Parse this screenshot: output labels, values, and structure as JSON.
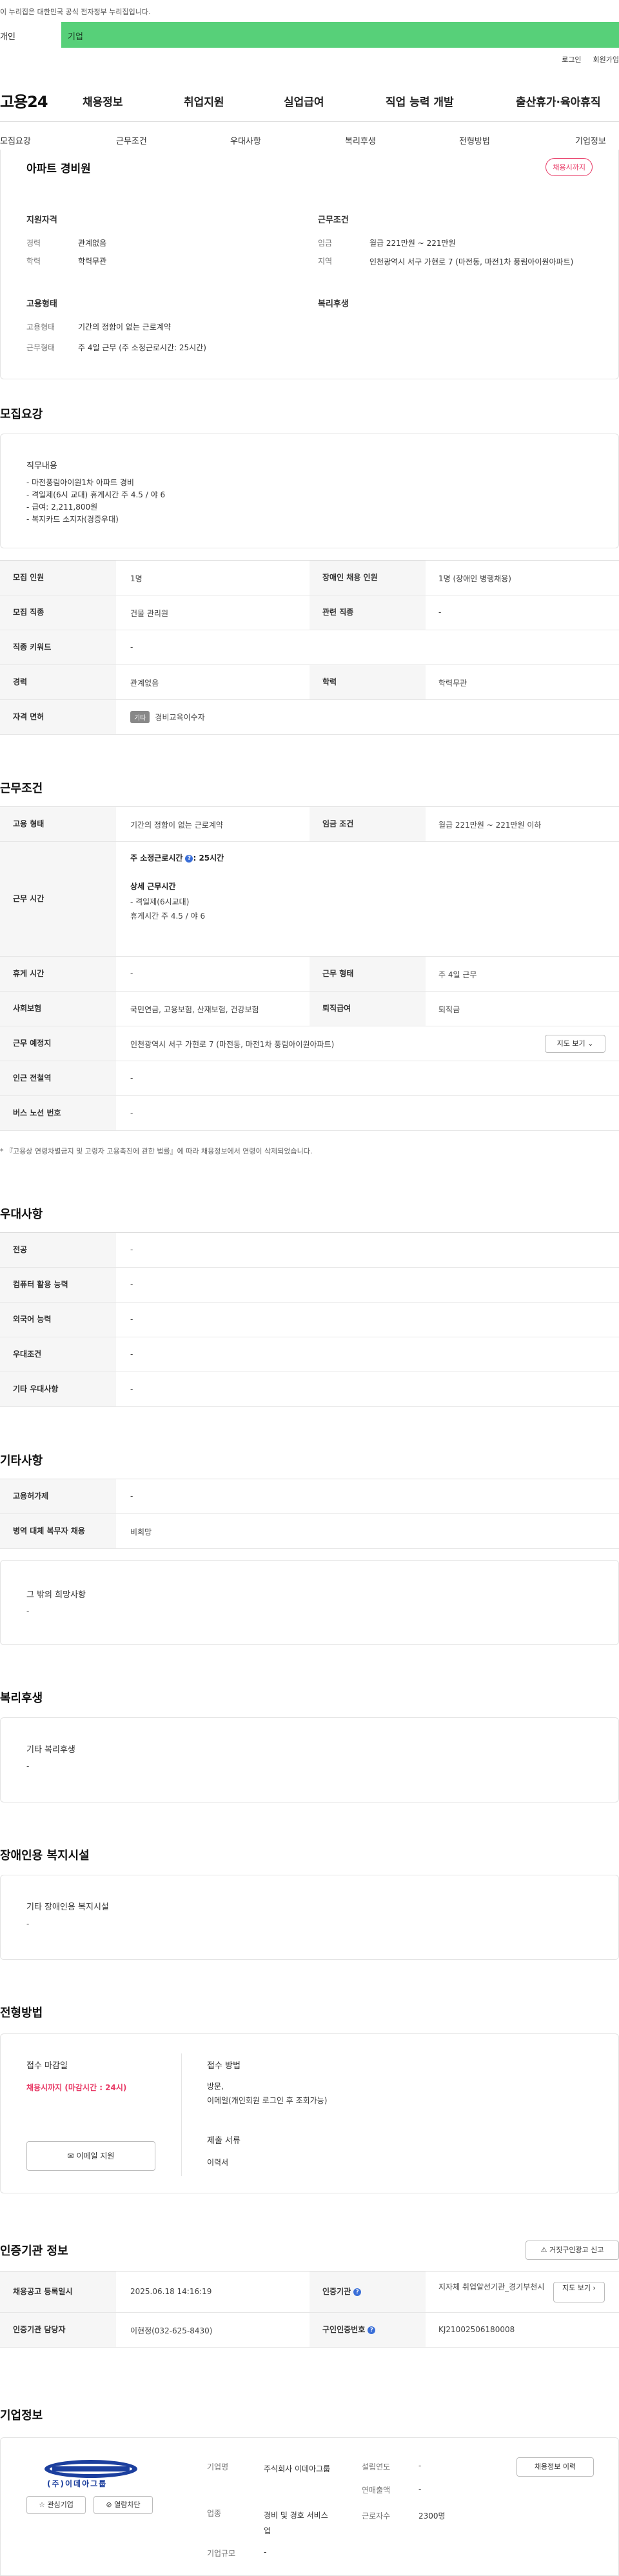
{
  "gov_banner": "이 누리집은 대한민국 공식 전자정부 누리집입니다.",
  "tabs": {
    "individual": "개인",
    "business": "기업"
  },
  "util": {
    "login": "로그인",
    "signup": "회원가입"
  },
  "logo": "고용24",
  "gnb": [
    "채용정보",
    "취업지원",
    "실업급여",
    "직업 능력 개발",
    "출산휴가·육아휴직"
  ],
  "subnav": [
    "모집요강",
    "근무조건",
    "우대사항",
    "복리후생",
    "전형방법",
    "기업정보"
  ],
  "summary": {
    "title": "아파트 경비원",
    "status_badge": "채용시까지",
    "qual_title": "지원자격",
    "career_label": "경력",
    "career_value": "관계없음",
    "edu_label": "학력",
    "edu_value": "학력무관",
    "emp_title": "고용형태",
    "emptype_label": "고용형태",
    "emptype_value": "기간의 정함이 없는 근로계약",
    "workform_label": "근무형태",
    "workform_value": "주 4일 근무 (주 소정근로시간: 25시간)",
    "cond_title": "근무조건",
    "wage_label": "임금",
    "wage_value": "월급 221만원 ~ 221만원",
    "region_label": "지역",
    "region_value": "인천광역시 서구 가현로 7 (마전동, 마전1차 풍림아이원아파트)",
    "welfare_title": "복리후생"
  },
  "recruit": {
    "section_title": "모집요강",
    "duty_title": "직무내용",
    "duty_text": "- 마전풍림아이원1차 아파트 경비\n- 격일제(6시 교대) 휴게시간 주 4.5 / 야 6\n- 급여: 2,211,800원\n- 복지카드 소지자(경증우대)",
    "rows": [
      {
        "h1": "모집 인원",
        "v1": "1명",
        "h2": "장애인 채용 인원",
        "v2": "1명 (장애인 병행채용)"
      },
      {
        "h1": "모집 직종",
        "v1": "건물 관리원",
        "h2": "관련 직종",
        "v2": "-"
      },
      {
        "h1": "직종 키워드",
        "v1": "-"
      },
      {
        "h1": "경력",
        "v1": "관계없음",
        "h2": "학력",
        "v2": "학력무관"
      },
      {
        "h1": "자격 면허",
        "chip": "기타",
        "v1": "경비교육이수자"
      }
    ]
  },
  "work": {
    "section_title": "근무조건",
    "emptype_h": "고용 형태",
    "emptype_v": "기간의 정함이 없는 근로계약",
    "wagecond_h": "임금 조건",
    "wagecond_v": "월급 221만원 ~ 221만원 이하",
    "hours_h": "근무 시간",
    "hours_main": "주 소정근로시간",
    "hours_main_val": ": 25시간",
    "hours_detail_title": "상세 근무시간",
    "hours_detail": "- 격일제(6시교대)\n휴게시간 주 4.5 / 야 6",
    "rest_h": "휴게 시간",
    "rest_v": "-",
    "form_h": "근무 형태",
    "form_v": "주 4일 근무",
    "insure_h": "사회보험",
    "insure_v": "국민연금, 고용보험, 산재보험, 건강보험",
    "retire_h": "퇴직급여",
    "retire_v": "퇴직금",
    "place_h": "근무 예정지",
    "place_v": "인천광역시 서구 가현로 7 (마전동, 마전1차 풍림아이원아파트)",
    "map_btn": "지도 보기",
    "subway_h": "인근 전철역",
    "subway_v": "-",
    "bus_h": "버스 노선 번호",
    "bus_v": "-",
    "note": "* 『고용상 연령차별금지 및 고령자 고용촉진에 관한 법률』에 따라 채용정보에서 연령이 삭제되었습니다."
  },
  "pref": {
    "section_title": "우대사항",
    "rows": [
      {
        "h": "전공",
        "v": "-"
      },
      {
        "h": "컴퓨터 활용 능력",
        "v": "-"
      },
      {
        "h": "외국어 능력",
        "v": "-"
      },
      {
        "h": "우대조건",
        "v": "-"
      },
      {
        "h": "기타 우대사항",
        "v": "-"
      }
    ]
  },
  "etc": {
    "section_title": "기타사항",
    "rows": [
      {
        "h": "고용허가제",
        "v": "-"
      },
      {
        "h": "병역 대체 복무자 채용",
        "v": "비희망"
      }
    ],
    "hope_title": "그 밖의 희망사항",
    "hope_value": "-"
  },
  "welfare": {
    "section_title": "복리후생",
    "box_title": "기타 복리후생",
    "box_value": "-"
  },
  "disabled": {
    "section_title": "장애인용 복지시설",
    "box_title": "기타 장애인용 복지시설",
    "box_value": "-"
  },
  "process": {
    "section_title": "전형방법",
    "deadline_title": "접수 마감일",
    "deadline_value": "채용시까지 (마감시간 : 24시)",
    "email_btn": "이메일 지원",
    "method_title": "접수 방법",
    "method_value": "방문,\n이메일(개인회원 로그인 후 조회가능)",
    "docs_title": "제출 서류",
    "docs_value": "이력서"
  },
  "cert": {
    "section_title": "인증기관 정보",
    "report_btn": "거짓구인광고 신고",
    "reg_h": "채용공고 등록일시",
    "reg_v": "2025.06.18 14:16:19",
    "agency_h": "인증기관",
    "agency_v": "지자체 취업알선기관_경기부천시",
    "map_btn": "지도 보기",
    "manager_h": "인증기관 담당자",
    "manager_v": "이현정(032-625-8430)",
    "authno_h": "구인인증번호",
    "authno_v": "KJ21002506180008"
  },
  "company": {
    "section_title": "기업정보",
    "logo_text": "(주)이데아그룹",
    "fav_btn": "관심기업",
    "block_btn": "열람차단",
    "name_l": "기업명",
    "name_v": "주식회사 이데아그룹",
    "est_l": "설립연도",
    "est_v": "-",
    "sales_l": "연매출액",
    "sales_v": "-",
    "industry_l": "업종",
    "industry_v": "경비 및 경호 서비스업",
    "staff_l": "근로자수",
    "staff_v": "2300명",
    "scale_l": "기업규모",
    "scale_v": "-",
    "detail_btn": "채용정보 이력"
  }
}
